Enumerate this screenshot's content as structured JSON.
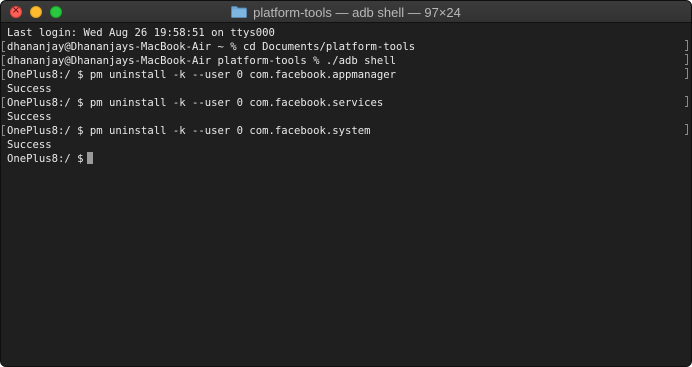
{
  "window": {
    "title": "platform-tools — adb shell — 97×24",
    "folder_icon": "folder-icon",
    "colors": {
      "close": "#fe5f57",
      "minimize": "#febc2e",
      "zoom": "#28c840",
      "background": "#1f1f1f",
      "text": "#e8e8e8"
    }
  },
  "terminal": {
    "lines": [
      "Last login: Wed Aug 26 19:58:51 on ttys000",
      "dhananjay@Dhananjays-MacBook-Air ~ % cd Documents/platform-tools",
      "dhananjay@Dhananjays-MacBook-Air platform-tools % ./adb shell",
      "OnePlus8:/ $ pm uninstall -k --user 0 com.facebook.appmanager",
      "Success",
      "OnePlus8:/ $ pm uninstall -k --user 0 com.facebook.services",
      "Success",
      "OnePlus8:/ $ pm uninstall -k --user 0 com.facebook.system",
      "Success",
      "OnePlus8:/ $"
    ]
  }
}
